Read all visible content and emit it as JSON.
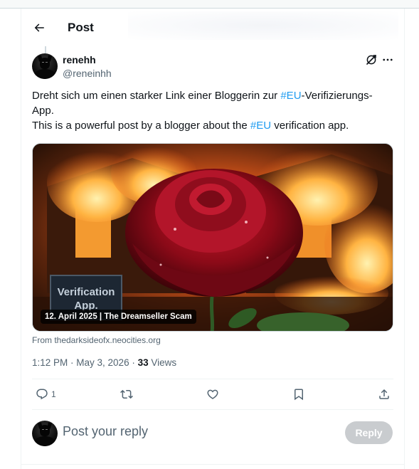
{
  "header": {
    "title": "Post",
    "back_icon": "arrow-left-icon"
  },
  "author": {
    "name": "renehh",
    "handle": "@reneinhh"
  },
  "tweet": {
    "line1_prefix": "Dreht sich um einen starker Link einer Bloggerin zur ",
    "line1_hashtag": "#EU",
    "line1_suffix": "-Verifizierungs-",
    "line2": "App.",
    "line3_prefix": "This is a powerful post by a blogger about the ",
    "line3_hashtag": "#EU",
    "line3_suffix": " verification app."
  },
  "media": {
    "caption": "12. April 2025 | The Dreamseller Scam",
    "sign_line1": "Verification",
    "sign_line2": "App.",
    "source": "From thedarksideofx.neocities.org"
  },
  "meta": {
    "time": "1:12 PM",
    "date": "May 3, 2026",
    "views_count": "33",
    "views_label": "Views"
  },
  "actions": {
    "reply_count": "1",
    "icons": [
      "reply-icon",
      "retweet-icon",
      "like-icon",
      "bookmark-icon",
      "share-icon"
    ]
  },
  "reply": {
    "placeholder": "Post your reply",
    "button_label": "Reply"
  },
  "colors": {
    "accent": "#1d9bf0",
    "text": "#0f1419",
    "secondary": "#536471",
    "reply_button_disabled": "#c9cccf"
  }
}
